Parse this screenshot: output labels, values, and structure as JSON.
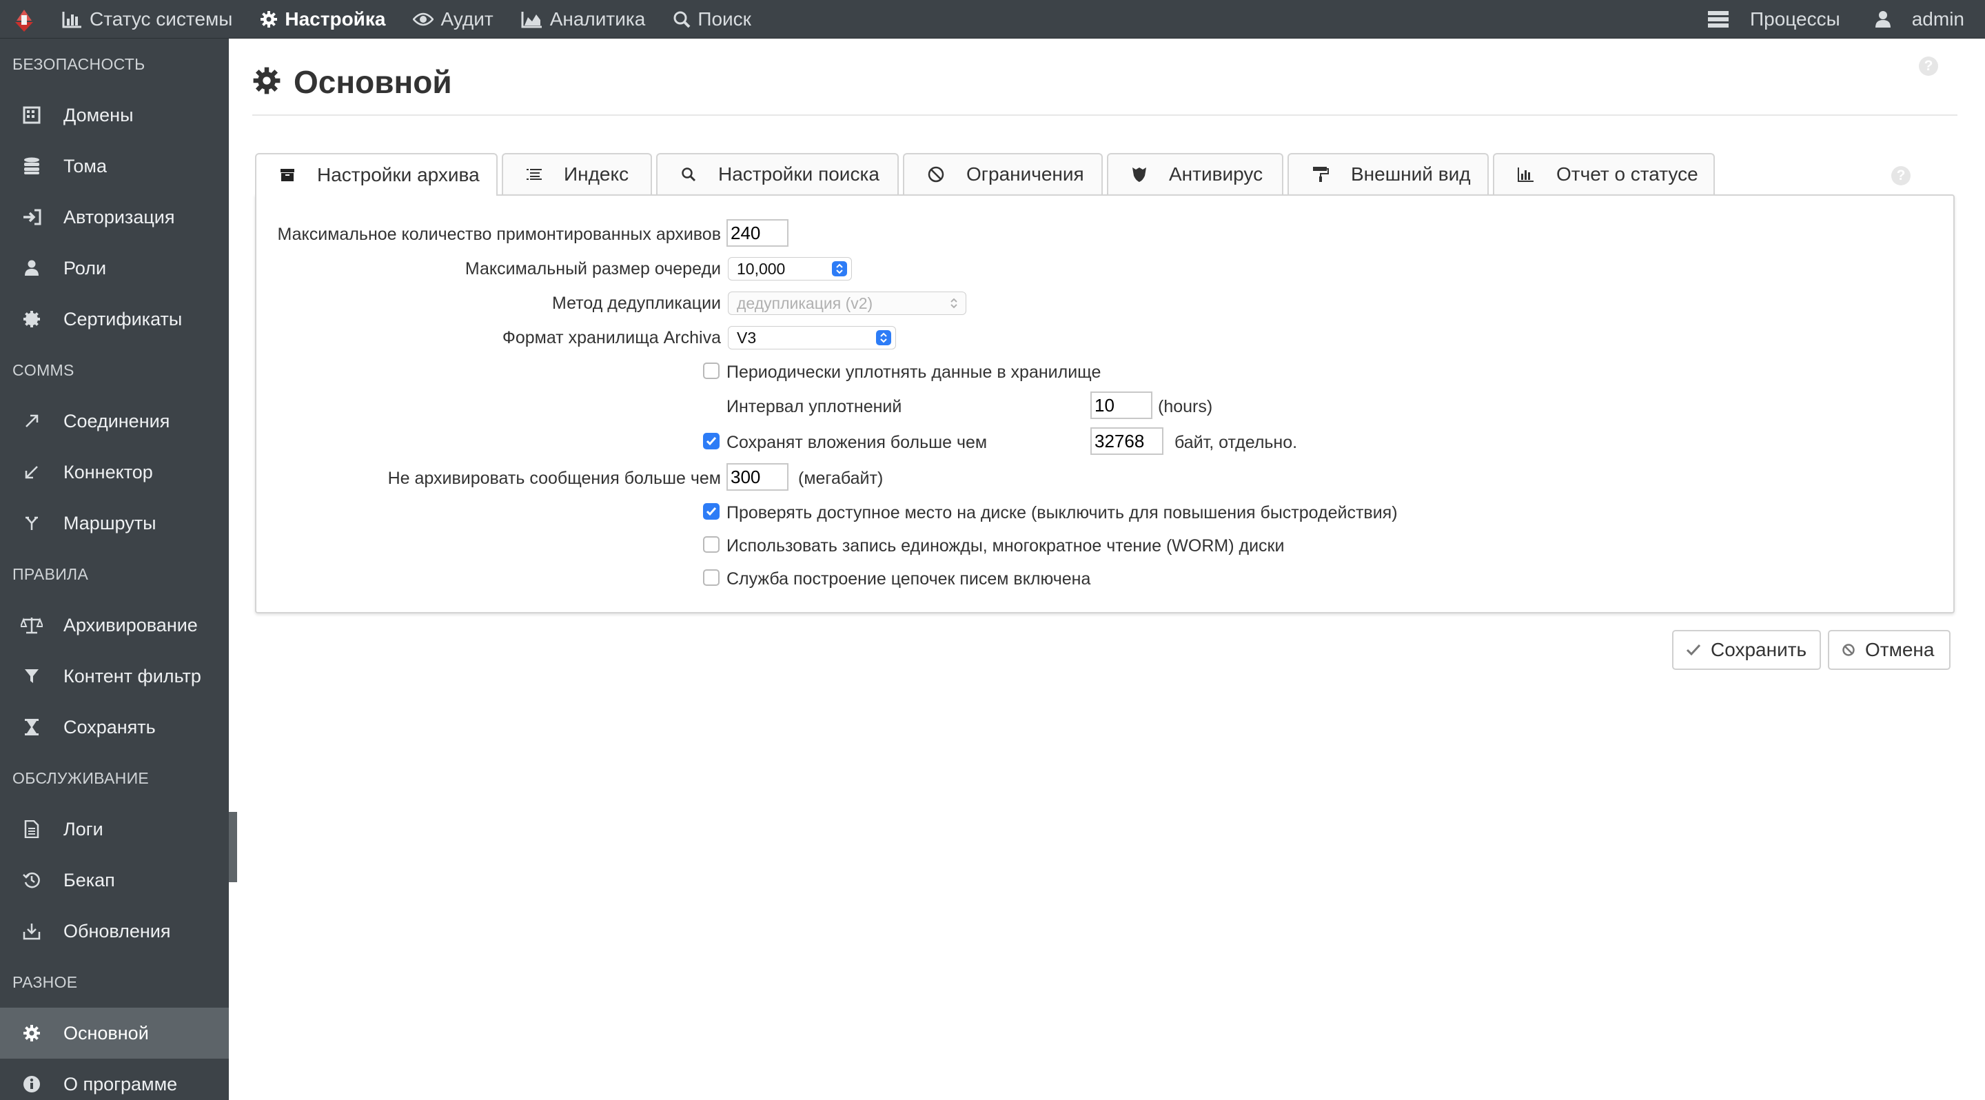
{
  "topnav": {
    "items": [
      {
        "label": "Статус системы",
        "icon": "bar-chart-icon"
      },
      {
        "label": "Настройка",
        "icon": "gear-icon"
      },
      {
        "label": "Аудит",
        "icon": "eye-icon"
      },
      {
        "label": "Аналитика",
        "icon": "area-chart-icon"
      },
      {
        "label": "Поиск",
        "icon": "search-icon"
      }
    ],
    "processes_label": "Процессы",
    "user_label": "admin"
  },
  "sidebar": {
    "sections": [
      {
        "title": "БЕЗОПАСНОСТЬ",
        "items": [
          "Домены",
          "Тома",
          "Авторизация",
          "Роли",
          "Сертификаты"
        ]
      },
      {
        "title": "COMMS",
        "items": [
          "Соединения",
          "Коннектор",
          "Маршруты"
        ]
      },
      {
        "title": "ПРАВИЛА",
        "items": [
          "Архивирование",
          "Контент фильтр",
          "Сохранять"
        ]
      },
      {
        "title": "ОБСЛУЖИВАНИЕ",
        "items": [
          "Логи",
          "Бекап",
          "Обновления"
        ]
      },
      {
        "title": "РАЗНОЕ",
        "items": [
          "Основной",
          "О программе"
        ]
      }
    ]
  },
  "page": {
    "title": "Основной",
    "help": "?"
  },
  "tabs": [
    "Настройки архива",
    "Индекс",
    "Настройки поиска",
    "Ограничения",
    "Антивирус",
    "Внешний вид",
    "Отчет о статусе"
  ],
  "form": {
    "max_mounted_label": "Максимальное количество примонтированных архивов",
    "max_mounted_value": "240",
    "queue_size_label": "Максимальный размер очереди",
    "queue_size_value": "10,000",
    "dedup_label": "Метод дедупликации",
    "dedup_value": "дедупликация (v2)",
    "storage_format_label": "Формат хранилища Archiva",
    "storage_format_value": "V3",
    "compact_label": "Периодически уплотнять данные в хранилище",
    "compact_checked": false,
    "compact_interval_label": "Интервал уплотнений",
    "compact_interval_value": "10",
    "compact_interval_unit": "(hours)",
    "attachments_label": "Сохранят вложения больше чем",
    "attachments_checked": true,
    "attachments_value": "32768",
    "attachments_unit": "байт, отдельно.",
    "no_archive_label": "Не архивировать сообщения больше чем",
    "no_archive_value": "300",
    "no_archive_unit": "(мегабайт)",
    "disk_check_label": "Проверять доступное место на диске (выключить для повышения быстродействия)",
    "disk_check_checked": true,
    "worm_label": "Использовать запись единожды, многократное чтение (WORM) диски",
    "worm_checked": false,
    "threading_label": "Служба построение цепочек писем включена",
    "threading_checked": false
  },
  "buttons": {
    "save": "Сохранить",
    "cancel": "Отмена"
  },
  "colors": {
    "nav_bg": "#3d4348",
    "active_item_bg": "#5d6469",
    "checkbox_blue": "#2d7cf6"
  }
}
